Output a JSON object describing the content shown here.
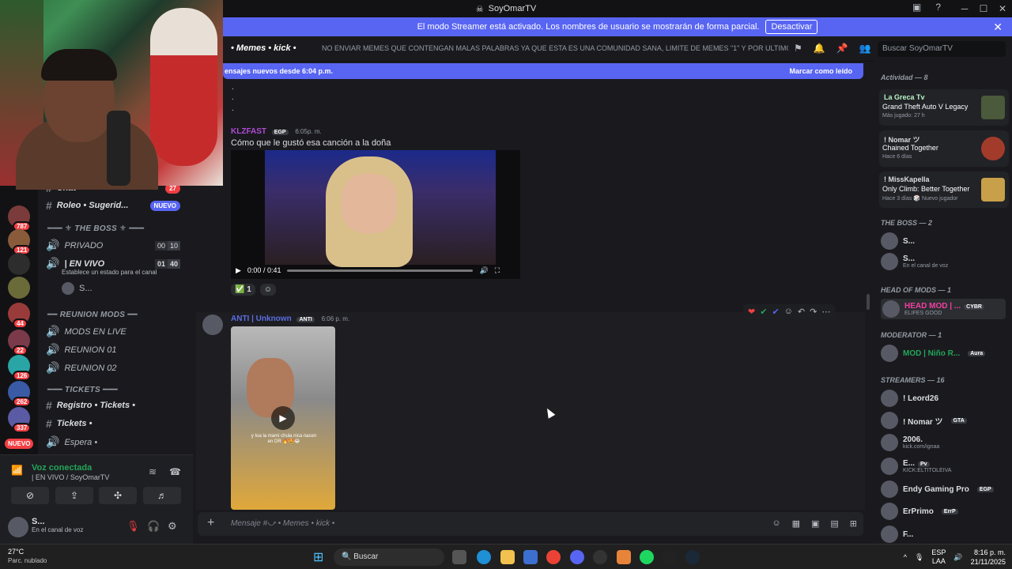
{
  "window": {
    "title": "SoyOmarTV",
    "minimize": "─",
    "maximize": "☐",
    "close": "✕"
  },
  "streamer_bar": {
    "text": "El modo Streamer está activado. Los nombres de usuario se mostrarán de forma parcial.",
    "button": "Desactivar",
    "close": "✕"
  },
  "channel": {
    "name": "• Memes • kick •",
    "topic": "NO ENVIAR MEMES QUE CONTENGAN MALAS PALABRAS YA QUE ESTA ES UNA COMUNIDAD SANA, LIMITE DE MEMES \"1\" Y POR ULTIMO EL ...",
    "search_placeholder": "Buscar SoyOmarTV"
  },
  "new_messages": {
    "text": "ensajes nuevos desde 6:04 p.m.",
    "action": "Marcar como leído"
  },
  "server_badges": [
    "787",
    "121",
    "44",
    "22",
    "126",
    "262",
    "337"
  ],
  "server_nuevo": "NUEVO",
  "channels": {
    "chat": "Chat •",
    "chat_count": "27",
    "roleo": "Roleo • Sugerid...",
    "roleo_pill": "NUEVO",
    "cat_boss": "THE BOSS",
    "privado": "PRIVADO",
    "privado_counts": [
      "00",
      "10"
    ],
    "en_vivo": "| EN VIVO",
    "en_vivo_counts": [
      "01",
      "40"
    ],
    "estado": "Establece un estado para el canal",
    "voice_user": "S...",
    "cat_reunion": "REUNION MODS",
    "mods_en_live": "MODS EN LIVE",
    "reunion01": "REUNION 01",
    "reunion02": "REUNION 02",
    "cat_tickets": "TICKETS",
    "registro": "Registro • Tickets •",
    "tickets": "Tickets •",
    "espera": "Espera •"
  },
  "voice": {
    "status": "Voz conectada",
    "channel": "| EN VIVO / SoyOmarTV"
  },
  "user": {
    "name": "S...",
    "status": "En el canal de voz"
  },
  "messages": [
    {
      "author": "KLZFAST",
      "tag": "EGP",
      "time": "6:05p. m.",
      "text": "Cómo que le gustó esa canción a la doña",
      "video_time": "0:00 / 0:41",
      "reaction_count": "1"
    },
    {
      "author": "ANTI | Unknown",
      "tag": "ANTI",
      "time": "6:06 p. m.",
      "video_caption": "y toa la mami chula nica nacen en DR 🔥🤩😂"
    }
  ],
  "composer": {
    "placeholder": "Mensaje #⤻ • Memes • kick •"
  },
  "activity": {
    "header": "Actividad — 8",
    "cards": [
      {
        "name": "La Greca Tv",
        "game": "Grand Theft Auto V Legacy",
        "meta": "Más jugado: 27 h"
      },
      {
        "name": "! Nomar ツ",
        "game": "Chained Together",
        "meta": "Hace 6 días"
      },
      {
        "name": "! MissKapella",
        "game": "Only Climb: Better Together",
        "meta": "Hace 3 días  🎲 Nuevo jugador"
      }
    ]
  },
  "member_groups": {
    "boss": "THE BOSS — 2",
    "boss_members": [
      {
        "name": "S...",
        "sub": ""
      },
      {
        "name": "S...",
        "sub": "En el canal de voz"
      }
    ],
    "head": "HEAD OF MODS — 1",
    "head_member": {
      "name": "HEAD MOD | ...",
      "tag": "CYBR",
      "sub": "ELIFES GOOD"
    },
    "moderator": "MODERATOR — 1",
    "mod_member": {
      "name": "MOD | Niño R...",
      "tag": "Aura"
    },
    "streamers": "STREAMERS — 16",
    "streamers_list": [
      {
        "name": "! Leord26",
        "tag": "",
        "sub": ""
      },
      {
        "name": "! Nomar ツ",
        "tag": "GTA",
        "sub": ""
      },
      {
        "name": "2006.",
        "tag": "",
        "sub": "kick.com/ignaa"
      },
      {
        "name": "E...",
        "tag": "Pv",
        "sub": "KICK:ELTITOLEIVA"
      },
      {
        "name": "Endy Gaming Pro",
        "tag": "EGP",
        "sub": ""
      },
      {
        "name": "ErPrimo",
        "tag": "ErrP",
        "sub": ""
      },
      {
        "name": "F...",
        "tag": "",
        "sub": ""
      }
    ]
  },
  "taskbar": {
    "temp": "27°C",
    "weather": "Parc. nublado",
    "search": "Buscar",
    "lang1": "ESP",
    "lang2": "LAA",
    "time": "8:16 p. m.",
    "date": "21/11/2025"
  }
}
